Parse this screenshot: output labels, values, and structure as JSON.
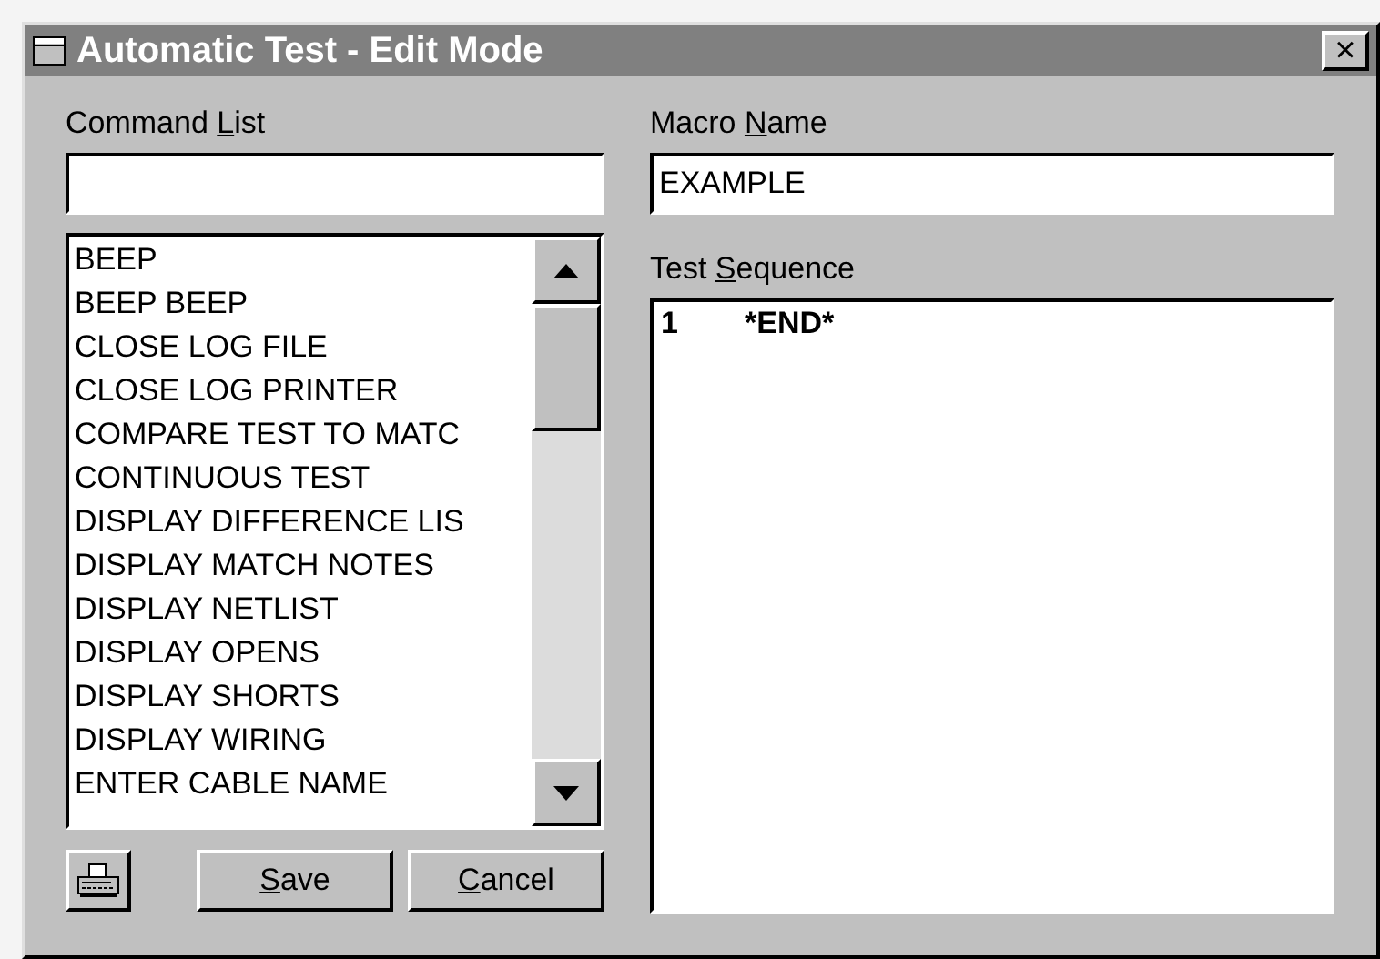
{
  "window": {
    "title": "Automatic Test - Edit Mode",
    "close": "×"
  },
  "command_list": {
    "label_before": "Command ",
    "label_key": "L",
    "label_after": "ist",
    "items": [
      "BEEP",
      "BEEP BEEP",
      "CLOSE LOG FILE",
      "CLOSE LOG PRINTER",
      "COMPARE TEST TO MATC",
      "CONTINUOUS TEST",
      "DISPLAY DIFFERENCE LIS",
      "DISPLAY MATCH NOTES",
      "DISPLAY NETLIST",
      "DISPLAY OPENS",
      "DISPLAY SHORTS",
      "DISPLAY WIRING",
      "ENTER CABLE NAME"
    ]
  },
  "macro_name": {
    "label_before": "Macro ",
    "label_key": "N",
    "label_after": "ame",
    "value": "EXAMPLE"
  },
  "test_sequence": {
    "label_before": "Test ",
    "label_key": "S",
    "label_after": "equence",
    "lines": [
      {
        "number": "1",
        "command": "*END*"
      }
    ]
  },
  "buttons": [
    {
      "key": "S",
      "rest": "ave"
    },
    {
      "key": "C",
      "rest": "ancel"
    }
  ]
}
